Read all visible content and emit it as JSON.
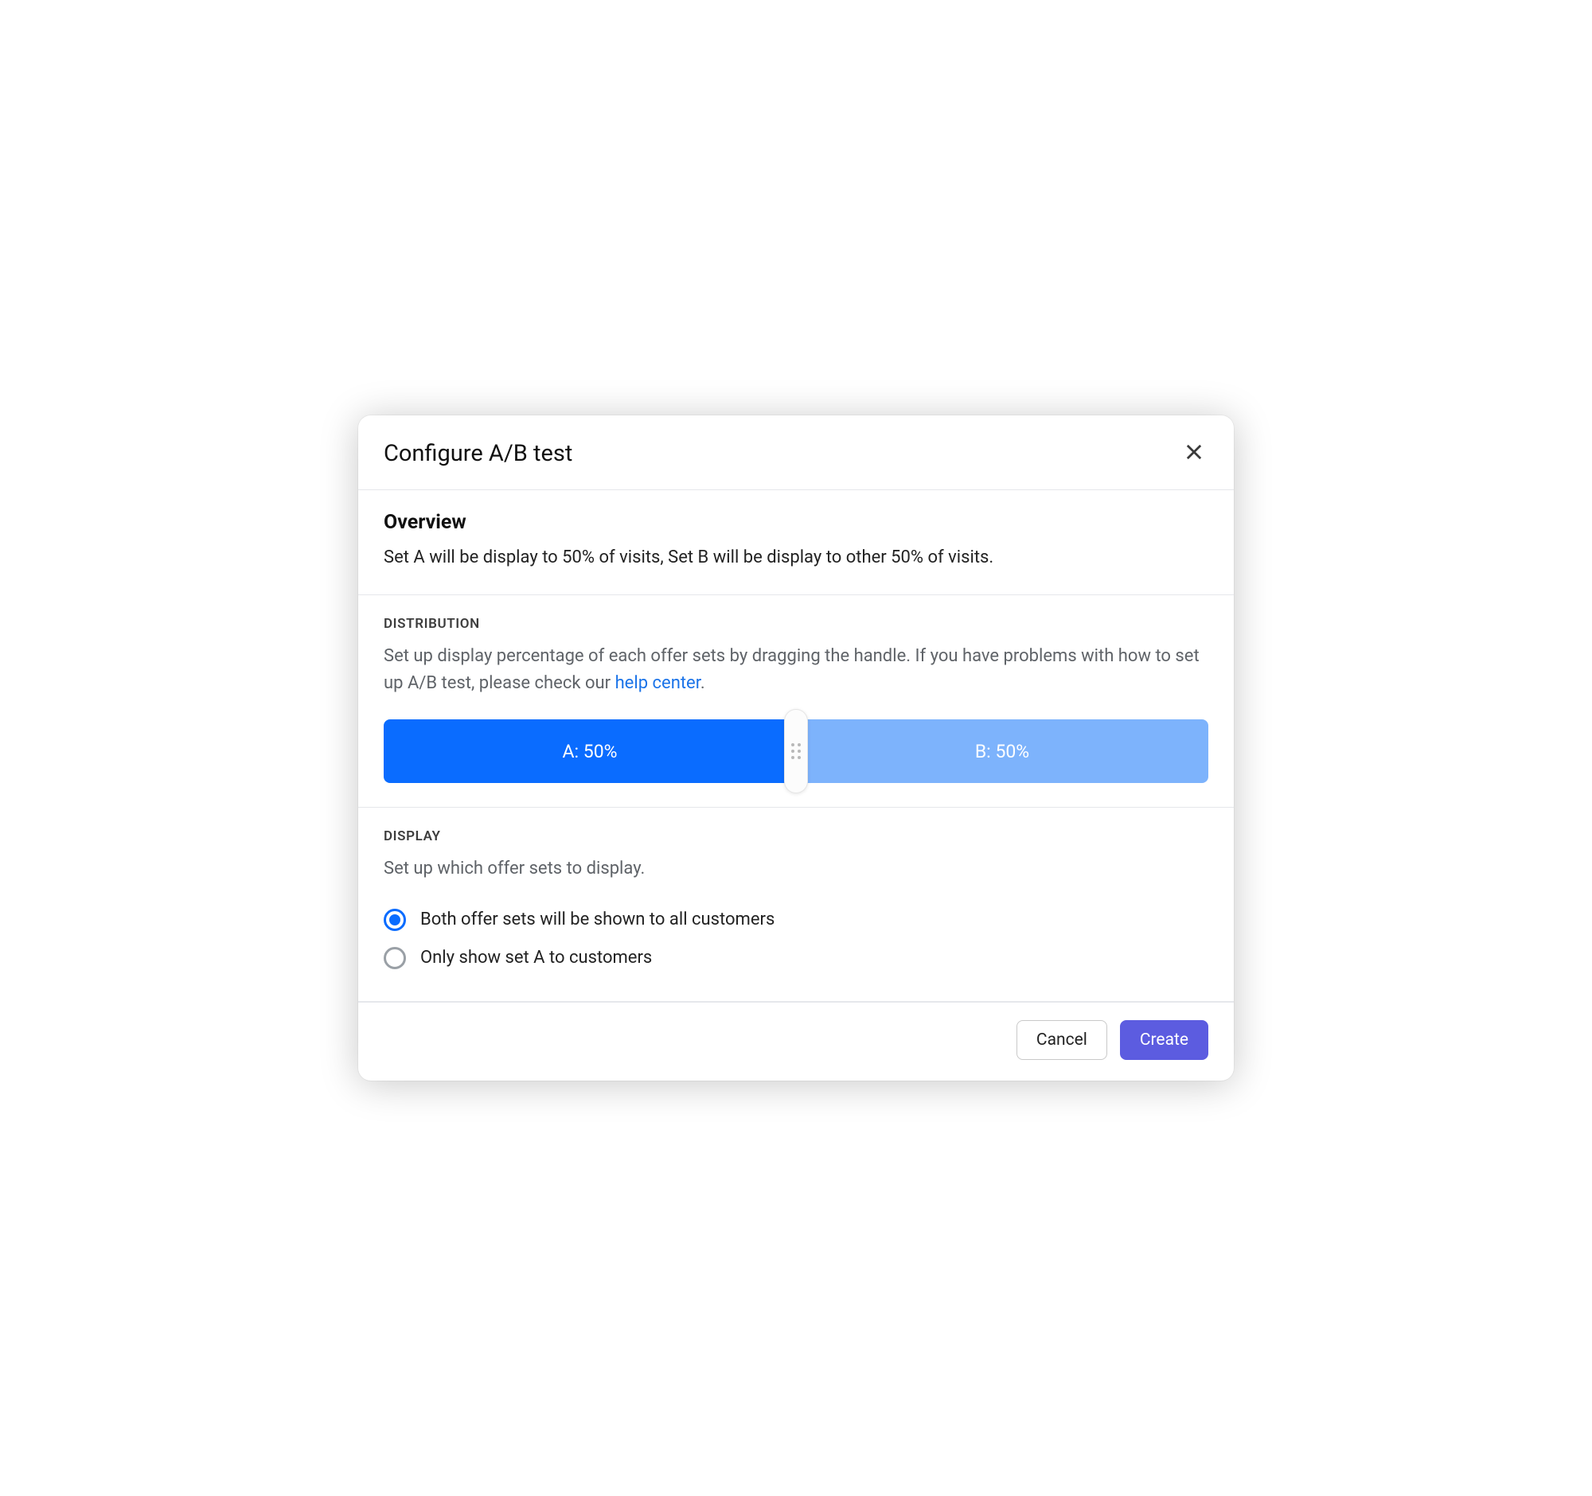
{
  "header": {
    "title": "Configure A/B test"
  },
  "overview": {
    "heading": "Overview",
    "text": "Set A will be display to 50% of visits, Set B will be display to other 50% of visits."
  },
  "distribution": {
    "label": "DISTRIBUTION",
    "description_before_link": "Set up display percentage of each offer sets by dragging the handle. If you have problems with how to set up A/B test, please check our ",
    "link_text": "help center",
    "description_after_link": ".",
    "slider": {
      "a_label": "A: 50%",
      "b_label": "B: 50%",
      "a_percent": 50,
      "b_percent": 50
    }
  },
  "display": {
    "label": "DISPLAY",
    "description": "Set up which offer sets to display.",
    "options": [
      {
        "label": "Both offer sets will be shown to all customers",
        "selected": true
      },
      {
        "label": "Only show set A to customers",
        "selected": false
      }
    ]
  },
  "footer": {
    "cancel": "Cancel",
    "create": "Create"
  },
  "colors": {
    "primary_blue": "#0a6cff",
    "light_blue": "#7db3fc",
    "action_purple": "#5c5ce0",
    "link_blue": "#1a73e8"
  }
}
